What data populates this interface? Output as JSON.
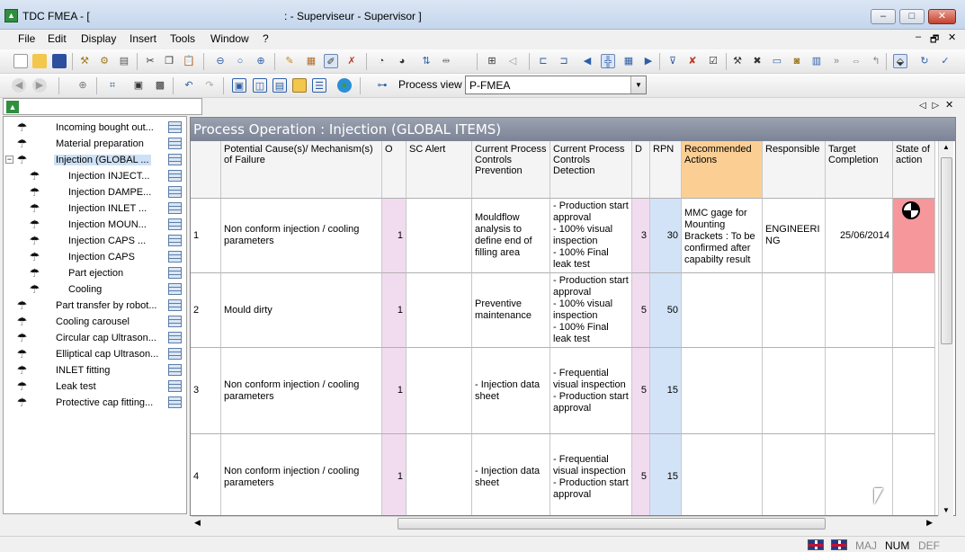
{
  "window": {
    "app_title": "TDC FMEA - [",
    "title_suffix": ": - Superviseur - Supervisor ]",
    "minimize": "–",
    "maximize": "□",
    "close": "✕"
  },
  "menu": {
    "items": [
      "File",
      "Edit",
      "Display",
      "Insert",
      "Tools",
      "Window",
      "?"
    ],
    "doc_controls": [
      "–",
      "🗗",
      "✕"
    ]
  },
  "toolbar2": {
    "process_view_label": "Process view",
    "view_select_value": "P-FMEA"
  },
  "tree": {
    "items": [
      {
        "label": "Incoming bought out...",
        "level": 0
      },
      {
        "label": "Material preparation",
        "level": 0
      },
      {
        "label": "Injection (GLOBAL ...",
        "level": 0,
        "selected": true,
        "expanded": true
      },
      {
        "label": "Injection INJECT...",
        "level": 1
      },
      {
        "label": "Injection DAMPE...",
        "level": 1
      },
      {
        "label": "Injection INLET ...",
        "level": 1
      },
      {
        "label": "Injection MOUN...",
        "level": 1
      },
      {
        "label": "Injection CAPS ...",
        "level": 1
      },
      {
        "label": "Injection CAPS",
        "level": 1
      },
      {
        "label": "Part ejection",
        "level": 1
      },
      {
        "label": "Cooling",
        "level": 1
      },
      {
        "label": "Part transfer by robot...",
        "level": 0
      },
      {
        "label": "Cooling carousel",
        "level": 0
      },
      {
        "label": "Circular cap Ultrason...",
        "level": 0
      },
      {
        "label": "Elliptical cap Ultrason...",
        "level": 0
      },
      {
        "label": "INLET fitting",
        "level": 0
      },
      {
        "label": "Leak test",
        "level": 0
      },
      {
        "label": "Protective cap fitting...",
        "level": 0
      }
    ]
  },
  "grid": {
    "section_title": "Process Operation : Injection (GLOBAL ITEMS)",
    "columns": [
      "",
      "Potential Cause(s)/ Mechanism(s) of Failure",
      "O",
      "SC Alert",
      "Current Process Controls Prevention",
      "Current Process Controls Detection",
      "D",
      "RPN",
      "Recommended Actions",
      "Responsible",
      "Target Completion",
      "State of action"
    ],
    "rows": [
      {
        "num": "1",
        "cause": "Non conform injection / cooling parameters",
        "o": "1",
        "sc": "",
        "prevention": "Mouldflow analysis to define end of filling area",
        "detection": "- Production start approval\n- 100% visual inspection\n- 100% Final leak test",
        "d": "3",
        "rpn": "30",
        "actions": "MMC gage for Mounting Brackets : To be confirmed after capabilty result",
        "responsible": "ENGINEERI NG",
        "target": "25/06/2014",
        "state": ""
      },
      {
        "num": "2",
        "cause": "Mould dirty",
        "o": "1",
        "sc": "",
        "prevention": "Preventive maintenance",
        "detection": "- Production start approval\n- 100% visual inspection\n- 100% Final leak test",
        "d": "5",
        "rpn": "50",
        "actions": "",
        "responsible": "",
        "target": "",
        "state": ""
      },
      {
        "num": "3",
        "cause": "Non conform injection / cooling parameters",
        "o": "1",
        "sc": "",
        "prevention": "- Injection data sheet",
        "detection": "- Frequential visual inspection\n- Production start approval",
        "d": "5",
        "rpn": "15",
        "actions": "",
        "responsible": "",
        "target": "",
        "state": ""
      },
      {
        "num": "4",
        "cause": "Non conform injection / cooling parameters",
        "o": "1",
        "sc": "",
        "prevention": "- Injection data sheet",
        "detection": "- Frequential visual inspection\n- Production start approval",
        "d": "5",
        "rpn": "15",
        "actions": "",
        "responsible": "",
        "target": "",
        "state": ""
      }
    ]
  },
  "status": {
    "maj": "MAJ",
    "num": "NUM",
    "def": "DEF"
  },
  "colors": {
    "occurrence_bg": "#f1dcef",
    "rpn_bg": "#d3e3f7",
    "recommended_header": "#fbcf94",
    "state_alert": "#f5979b",
    "title_bar": "#7b8395"
  }
}
